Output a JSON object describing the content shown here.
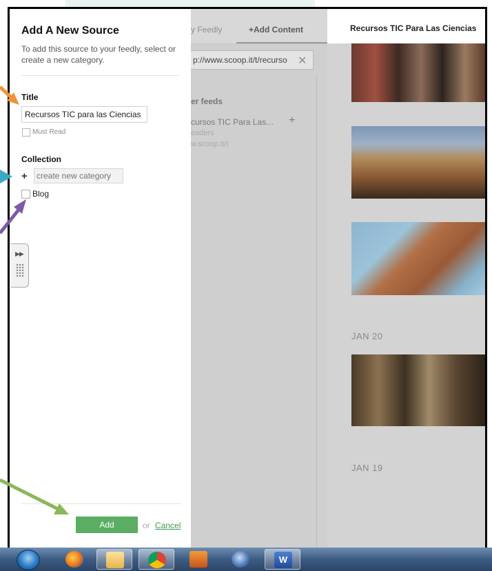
{
  "middle": {
    "tab_feedly": "y Feedly",
    "tab_add_content": "+Add Content",
    "url_value": "p://www.scoop.it/t/recurso",
    "url_clear_icon": "close-icon",
    "section_label": "er feeds",
    "feed_title": "cursos TIC Para Las…",
    "feed_add_icon": "plus-icon",
    "feed_readers": "eaders",
    "feed_site": "w.scoop.it/t"
  },
  "right_panel": {
    "title": "Recursos TIC Para Las Ciencias",
    "date_1": "JAN 20",
    "date_2": "JAN 19"
  },
  "dialog": {
    "title": "Add A New Source",
    "description": "To add this source to your feedly, select or create a new category.",
    "title_label": "Title",
    "title_value": "Recursos TIC para las Ciencias",
    "must_read_label": "Must Read",
    "collection_label": "Collection",
    "category_placeholder": "create new category",
    "blog_label": "Blog",
    "add_button": "Add",
    "or_text": "or",
    "cancel_link": "Cancel"
  },
  "colors": {
    "accent_green": "#5aad62",
    "arrow_orange": "#f0923a",
    "arrow_blue": "#3aa9c9",
    "arrow_purple": "#7d5aa6",
    "arrow_green": "#8ab85a"
  },
  "taskbar": {
    "icons": [
      "start-orb-icon",
      "firefox-icon",
      "folder-icon",
      "chrome-icon",
      "media-player-icon",
      "thunderbird-icon",
      "word-icon"
    ],
    "word_glyph": "W"
  }
}
